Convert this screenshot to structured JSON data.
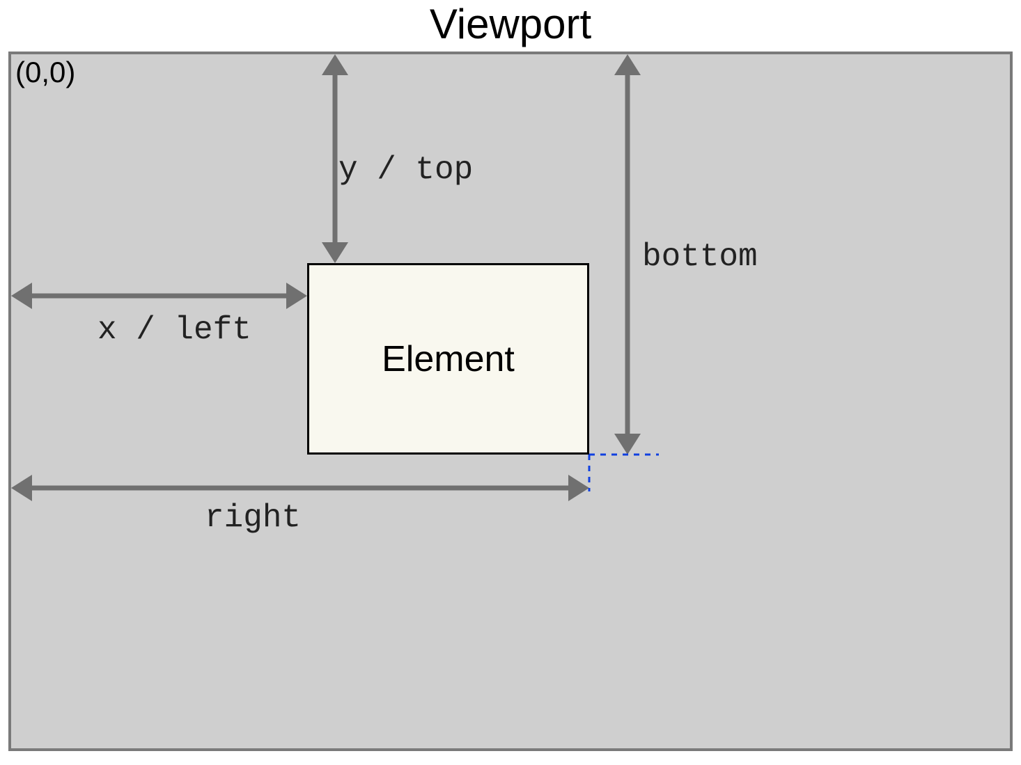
{
  "title": "Viewport",
  "origin": "(0,0)",
  "element_label": "Element",
  "labels": {
    "y_top": "y / top",
    "x_left": "x / left",
    "bottom": "bottom",
    "right": "right"
  }
}
